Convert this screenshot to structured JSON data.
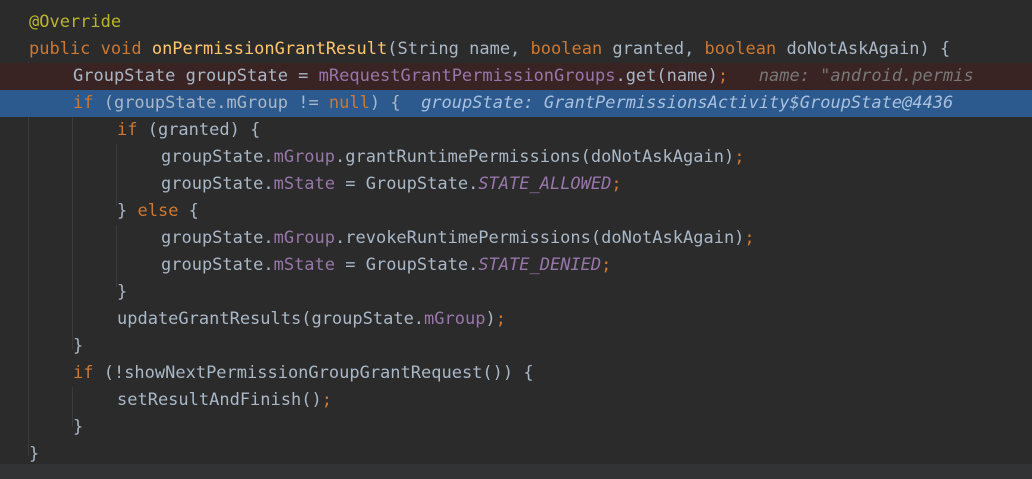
{
  "lines": [
    {
      "tokens": [
        {
          "t": "@Override",
          "c": "ann"
        }
      ]
    },
    {
      "tokens": [
        {
          "t": "public void ",
          "c": "kw"
        },
        {
          "t": "onPermissionGrantResult",
          "c": "fn"
        },
        {
          "t": "(String name, ",
          "c": "pl"
        },
        {
          "t": "boolean ",
          "c": "kw"
        },
        {
          "t": "granted, ",
          "c": "pl"
        },
        {
          "t": "boolean ",
          "c": "kw"
        },
        {
          "t": "doNotAskAgain) {",
          "c": "pl"
        }
      ]
    },
    {
      "tokens": [
        {
          "t": "GroupState groupState = ",
          "c": "pl"
        },
        {
          "t": "mRequestGrantPermissionGroups",
          "c": "fld"
        },
        {
          "t": ".get(name)",
          "c": "pl"
        },
        {
          "t": ";",
          "c": "kw"
        },
        {
          "t": "   name: \"android.permis",
          "c": "hint"
        }
      ]
    },
    {
      "tokens": [
        {
          "t": "if ",
          "c": "kw"
        },
        {
          "t": "(groupState.",
          "c": "pl"
        },
        {
          "t": "mGroup ",
          "c": "fld"
        },
        {
          "t": "!= ",
          "c": "pl"
        },
        {
          "t": "null",
          "c": "kw"
        },
        {
          "t": ") {",
          "c": "pl"
        },
        {
          "t": "  groupState: GrantPermissionsActivity$GroupState@4436",
          "c": "hint"
        }
      ]
    },
    {
      "tokens": [
        {
          "t": "if ",
          "c": "kw"
        },
        {
          "t": "(granted) {",
          "c": "pl"
        }
      ]
    },
    {
      "tokens": [
        {
          "t": "groupState.",
          "c": "pl"
        },
        {
          "t": "mGroup",
          "c": "fld"
        },
        {
          "t": ".grantRuntimePermissions(doNotAskAgain)",
          "c": "pl"
        },
        {
          "t": ";",
          "c": "kw"
        }
      ]
    },
    {
      "tokens": [
        {
          "t": "groupState.",
          "c": "pl"
        },
        {
          "t": "mState ",
          "c": "fld"
        },
        {
          "t": "= GroupState.",
          "c": "pl"
        },
        {
          "t": "STATE_ALLOWED",
          "c": "stat"
        },
        {
          "t": ";",
          "c": "kw"
        }
      ]
    },
    {
      "tokens": [
        {
          "t": "} ",
          "c": "pl"
        },
        {
          "t": "else ",
          "c": "kw"
        },
        {
          "t": "{",
          "c": "pl"
        }
      ]
    },
    {
      "tokens": [
        {
          "t": "groupState.",
          "c": "pl"
        },
        {
          "t": "mGroup",
          "c": "fld"
        },
        {
          "t": ".revokeRuntimePermissions(doNotAskAgain)",
          "c": "pl"
        },
        {
          "t": ";",
          "c": "kw"
        }
      ]
    },
    {
      "tokens": [
        {
          "t": "groupState.",
          "c": "pl"
        },
        {
          "t": "mState ",
          "c": "fld"
        },
        {
          "t": "= GroupState.",
          "c": "pl"
        },
        {
          "t": "STATE_DENIED",
          "c": "stat"
        },
        {
          "t": ";",
          "c": "kw"
        }
      ]
    },
    {
      "tokens": [
        {
          "t": "}",
          "c": "pl"
        }
      ]
    },
    {
      "tokens": [
        {
          "t": "updateGrantResults(groupState.",
          "c": "pl"
        },
        {
          "t": "mGroup",
          "c": "fld"
        },
        {
          "t": ")",
          "c": "pl"
        },
        {
          "t": ";",
          "c": "kw"
        }
      ]
    },
    {
      "tokens": [
        {
          "t": "}",
          "c": "pl"
        }
      ]
    },
    {
      "tokens": [
        {
          "t": "if ",
          "c": "kw"
        },
        {
          "t": "(!showNextPermissionGroupGrantRequest()) {",
          "c": "pl"
        }
      ]
    },
    {
      "tokens": [
        {
          "t": "setResultAndFinish()",
          "c": "pl"
        },
        {
          "t": ";",
          "c": "kw"
        }
      ]
    },
    {
      "tokens": [
        {
          "t": "}",
          "c": "pl"
        }
      ]
    },
    {
      "tokens": [
        {
          "t": "}",
          "c": "pl"
        }
      ]
    }
  ]
}
